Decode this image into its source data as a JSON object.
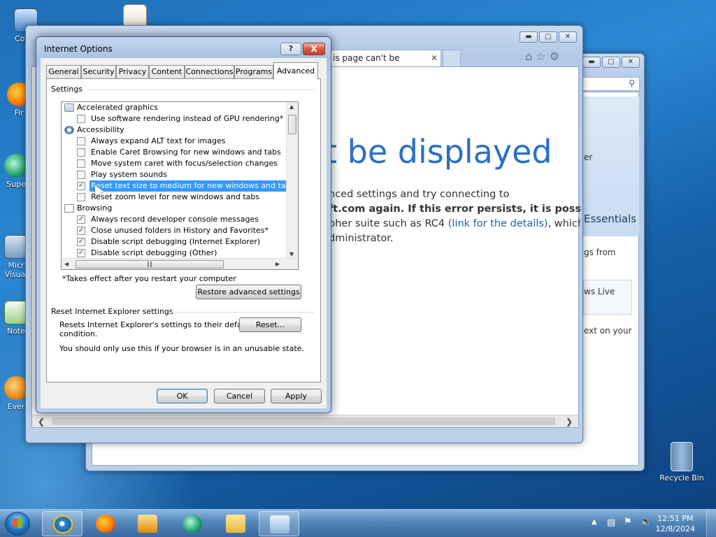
{
  "desktop": {
    "icons": [
      {
        "label": "Comp"
      },
      {
        "label": "Fir"
      },
      {
        "label": "Supe"
      },
      {
        "label": "Micr"
      },
      {
        "label": "Visual"
      },
      {
        "label": "Note"
      },
      {
        "label": "Ever"
      }
    ],
    "recycle_bin": "Recycle Bin"
  },
  "browser": {
    "tab_title": "is page can't be displayed",
    "heading": "t be displayed",
    "body_lines": [
      "nced settings and try connecting to",
      "ft.com again. If this error persists, it is possible tha",
      "pher suite such as RC4 ",
      "dministrator."
    ],
    "link_text": "(link for the details)",
    "after_link": ", which is ",
    "bg_window": {
      "side1": "er",
      "essentials": "Essentials",
      "side2": "gs from",
      "side3": "ws Live",
      "side4": "ext on your"
    }
  },
  "dialog": {
    "title": "Internet Options",
    "help": "?",
    "close": "X",
    "tabs": [
      "General",
      "Security",
      "Privacy",
      "Content",
      "Connections",
      "Programs",
      "Advanced"
    ],
    "active_tab": "Advanced",
    "settings_label": "Settings",
    "tree": [
      {
        "type": "category",
        "text": "Accelerated graphics"
      },
      {
        "type": "option",
        "text": "Use software rendering instead of GPU rendering*",
        "checked": false
      },
      {
        "type": "category",
        "text": "Accessibility"
      },
      {
        "type": "option",
        "text": "Always expand ALT text for images",
        "checked": false
      },
      {
        "type": "option",
        "text": "Enable Caret Browsing for new windows and tabs",
        "checked": false
      },
      {
        "type": "option",
        "text": "Move system caret with focus/selection changes",
        "checked": false
      },
      {
        "type": "option",
        "text": "Play system sounds",
        "checked": false
      },
      {
        "type": "option",
        "text": "Reset text size to medium for new windows and tabs",
        "checked": true,
        "selected": true
      },
      {
        "type": "option",
        "text": "Reset zoom level for new windows and tabs",
        "checked": false
      },
      {
        "type": "category",
        "text": "Browsing"
      },
      {
        "type": "option",
        "text": "Always record developer console messages",
        "checked": true
      },
      {
        "type": "option",
        "text": "Close unused folders in History and Favorites*",
        "checked": true
      },
      {
        "type": "option",
        "text": "Disable script debugging (Internet Explorer)",
        "checked": true
      },
      {
        "type": "option",
        "text": "Disable script debugging (Other)",
        "checked": true
      }
    ],
    "restart_note": "*Takes effect after you restart your computer",
    "restore_button": "Restore advanced settings",
    "reset_group_label": "Reset Internet Explorer settings",
    "reset_desc_1": "Resets Internet Explorer's settings to their default",
    "reset_desc_2": "condition.",
    "reset_button": "Reset...",
    "reset_warning": "You should only use this if your browser is in an unusable state.",
    "ok": "OK",
    "cancel": "Cancel",
    "apply": "Apply"
  },
  "taskbar": {
    "time": "12:51 PM",
    "date": "12/8/2024"
  }
}
